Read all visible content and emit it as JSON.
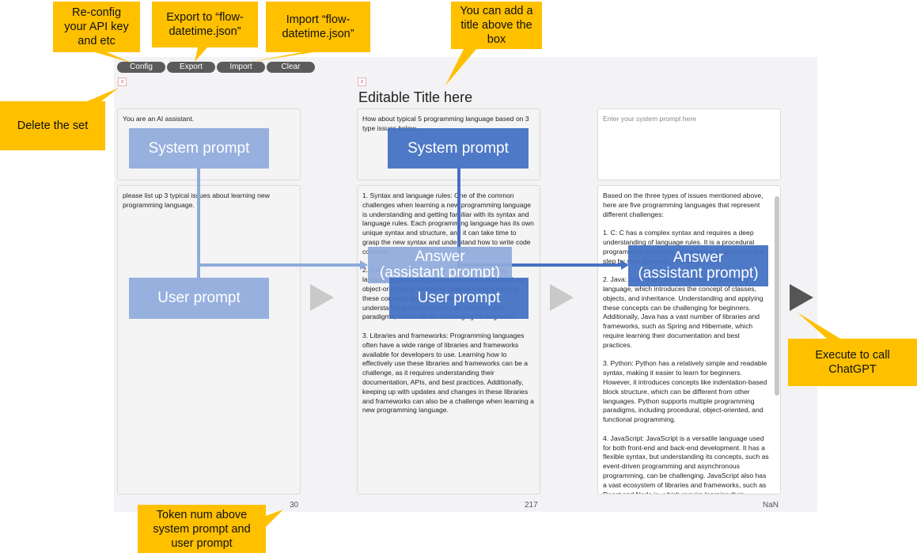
{
  "toolbar": {
    "config": "Config",
    "export": "Export",
    "import": "Import",
    "clear": "Clear"
  },
  "delete_label": "x",
  "panel_title": "Editable Title here",
  "panels": [
    {
      "system": "You are an AI assistant.",
      "user": "please list up 3 typical issues about learning new programming language.",
      "token": "30"
    },
    {
      "system": "How about typical 5 programming language based on 3 type issues below.",
      "user": "1. Syntax and language rules: One of the common challenges when learning a new programming language is understanding and getting familiar with its syntax and language rules. Each programming language has its own unique syntax and structure, and it can take time to grasp the new syntax and understand how to write code correctly.\n\n2. Concepts and paradigms: Each programming language comes with its own set of concepts, such as object-oriented or functional programming. Learning these concepts and paradigms often involves understanding fundamental code concepts and paradigms, which can be challenging for beginners.\n\n3. Libraries and frameworks: Programming languages often have a wide range of libraries and frameworks available for developers to use. Learning how to effectively use these libraries and frameworks can be a challenge, as it requires understanding their documentation, APIs, and best practices. Additionally, keeping up with updates and changes in these libraries and frameworks can also be a challenge when learning a new programming language.",
      "token": "217"
    },
    {
      "system_placeholder": "Enter your system prompt here",
      "user": "Based on the three types of issues mentioned above, here are five programming languages that represent different challenges:\n\n1. C: C has a complex syntax and requires a deep understanding of language rules. It is a procedural programming language, and learning it can become a step by step approach to coding.\n\n2. Java: Java is an object-oriented programming language, which introduces the concept of classes, objects, and inheritance. Understanding and applying these concepts can be challenging for beginners. Additionally, Java has a vast number of libraries and frameworks, such as Spring and Hibernate, which require learning their documentation and best practices.\n\n3. Python: Python has a relatively simple and readable syntax, making it easier to learn for beginners. However, it introduces concepts like indentation-based block structure, which can be different from other languages. Python supports multiple programming paradigms, including procedural, object-oriented, and functional programming.\n\n4. JavaScript: JavaScript is a versatile language used for both front-end and back-end development. It has a flexible syntax, but understanding its concepts, such as event-driven programming and asynchronous programming, can be challenging. JavaScript also has a vast ecosystem of libraries and frameworks, such as React and Node.js, which require learning their",
      "token": "NaN"
    }
  ],
  "overlays": {
    "system_prompt": "System prompt",
    "user_prompt": "User prompt",
    "answer_line1": "Answer",
    "answer_line2": "(assistant prompt)"
  },
  "callouts": {
    "config": [
      "Re-config",
      "your API key",
      "and etc"
    ],
    "export": [
      "Export to “flow-",
      "datetime.json”"
    ],
    "import": [
      "Import “flow-",
      "datetime.json”"
    ],
    "title": [
      "You can add a",
      "title above the",
      "box"
    ],
    "delete": [
      "Delete the set"
    ],
    "execute": [
      "Execute to call",
      "ChatGPT"
    ],
    "token": [
      "Token num above",
      "system prompt and",
      "user prompt"
    ]
  },
  "colors": {
    "callout": "#ffc000",
    "overlay_light": "#8faadc",
    "overlay_dark": "#4472c4",
    "button": "#5b5b5b"
  }
}
